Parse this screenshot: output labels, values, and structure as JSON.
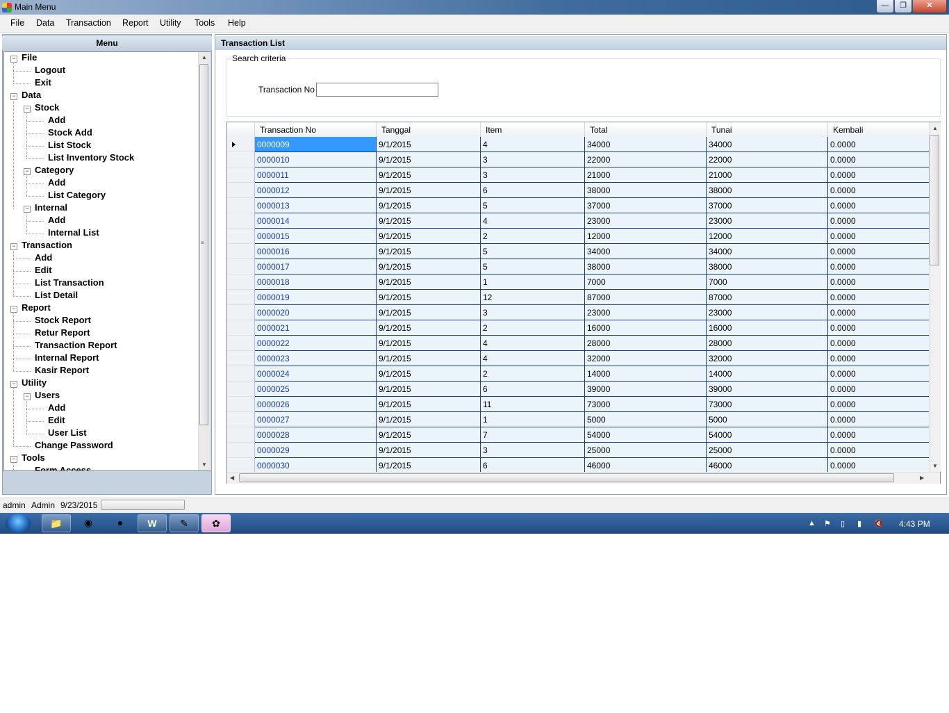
{
  "window": {
    "title": "Main Menu"
  },
  "menubar": [
    "File",
    "Data",
    "Transaction",
    "Report",
    "Utility",
    "Tools",
    "Help"
  ],
  "left_panel": {
    "title": "Menu"
  },
  "tree": [
    {
      "label": "File",
      "level": 0,
      "expanded": true
    },
    {
      "label": "Logout",
      "level": 1
    },
    {
      "label": "Exit",
      "level": 1
    },
    {
      "label": "Data",
      "level": 0,
      "expanded": true
    },
    {
      "label": "Stock",
      "level": 1,
      "expanded": true
    },
    {
      "label": "Add",
      "level": 2
    },
    {
      "label": "Stock Add",
      "level": 2
    },
    {
      "label": "List Stock",
      "level": 2
    },
    {
      "label": "List Inventory Stock",
      "level": 2
    },
    {
      "label": "Category",
      "level": 1,
      "expanded": true
    },
    {
      "label": "Add",
      "level": 2
    },
    {
      "label": "List Category",
      "level": 2
    },
    {
      "label": "Internal",
      "level": 1,
      "expanded": true
    },
    {
      "label": "Add",
      "level": 2
    },
    {
      "label": "Internal List",
      "level": 2
    },
    {
      "label": "Transaction",
      "level": 0,
      "expanded": true
    },
    {
      "label": "Add",
      "level": 1
    },
    {
      "label": "Edit",
      "level": 1
    },
    {
      "label": "List Transaction",
      "level": 1
    },
    {
      "label": "List Detail",
      "level": 1
    },
    {
      "label": "Report",
      "level": 0,
      "expanded": true
    },
    {
      "label": "Stock Report",
      "level": 1
    },
    {
      "label": "Retur Report",
      "level": 1
    },
    {
      "label": "Transaction Report",
      "level": 1
    },
    {
      "label": "Internal Report",
      "level": 1
    },
    {
      "label": "Kasir Report",
      "level": 1
    },
    {
      "label": "Utility",
      "level": 0,
      "expanded": true
    },
    {
      "label": "Users",
      "level": 1,
      "expanded": true
    },
    {
      "label": "Add",
      "level": 2
    },
    {
      "label": "Edit",
      "level": 2
    },
    {
      "label": "User List",
      "level": 2
    },
    {
      "label": "Change Password",
      "level": 1
    },
    {
      "label": "Tools",
      "level": 0,
      "expanded": true
    },
    {
      "label": "Form Access",
      "level": 1
    }
  ],
  "right_panel": {
    "title": "Transaction List",
    "search_legend": "Search criteria",
    "transaction_no_label": "Transaction No",
    "transaction_no_value": ""
  },
  "grid": {
    "columns": [
      "Transaction No",
      "Tanggal",
      "Item",
      "Total",
      "Tunai",
      "Kembali"
    ],
    "selected_row": 0,
    "rows": [
      [
        "0000009",
        "9/1/2015",
        "4",
        "34000",
        "34000",
        "0.0000"
      ],
      [
        "0000010",
        "9/1/2015",
        "3",
        "22000",
        "22000",
        "0.0000"
      ],
      [
        "0000011",
        "9/1/2015",
        "3",
        "21000",
        "21000",
        "0.0000"
      ],
      [
        "0000012",
        "9/1/2015",
        "6",
        "38000",
        "38000",
        "0.0000"
      ],
      [
        "0000013",
        "9/1/2015",
        "5",
        "37000",
        "37000",
        "0.0000"
      ],
      [
        "0000014",
        "9/1/2015",
        "4",
        "23000",
        "23000",
        "0.0000"
      ],
      [
        "0000015",
        "9/1/2015",
        "2",
        "12000",
        "12000",
        "0.0000"
      ],
      [
        "0000016",
        "9/1/2015",
        "5",
        "34000",
        "34000",
        "0.0000"
      ],
      [
        "0000017",
        "9/1/2015",
        "5",
        "38000",
        "38000",
        "0.0000"
      ],
      [
        "0000018",
        "9/1/2015",
        "1",
        "7000",
        "7000",
        "0.0000"
      ],
      [
        "0000019",
        "9/1/2015",
        "12",
        "87000",
        "87000",
        "0.0000"
      ],
      [
        "0000020",
        "9/1/2015",
        "3",
        "23000",
        "23000",
        "0.0000"
      ],
      [
        "0000021",
        "9/1/2015",
        "2",
        "16000",
        "16000",
        "0.0000"
      ],
      [
        "0000022",
        "9/1/2015",
        "4",
        "28000",
        "28000",
        "0.0000"
      ],
      [
        "0000023",
        "9/1/2015",
        "4",
        "32000",
        "32000",
        "0.0000"
      ],
      [
        "0000024",
        "9/1/2015",
        "2",
        "14000",
        "14000",
        "0.0000"
      ],
      [
        "0000025",
        "9/1/2015",
        "6",
        "39000",
        "39000",
        "0.0000"
      ],
      [
        "0000026",
        "9/1/2015",
        "11",
        "73000",
        "73000",
        "0.0000"
      ],
      [
        "0000027",
        "9/1/2015",
        "1",
        "5000",
        "5000",
        "0.0000"
      ],
      [
        "0000028",
        "9/1/2015",
        "7",
        "54000",
        "54000",
        "0.0000"
      ],
      [
        "0000029",
        "9/1/2015",
        "3",
        "25000",
        "25000",
        "0.0000"
      ],
      [
        "0000030",
        "9/1/2015",
        "6",
        "46000",
        "46000",
        "0.0000"
      ]
    ]
  },
  "statusbar": {
    "user_id": "admin",
    "user_name": "Admin",
    "date": "9/23/2015"
  },
  "taskbar": {
    "apps": [
      "file-explorer-icon",
      "chrome-icon",
      "firefox-icon",
      "word-icon",
      "paint-icon",
      "main-menu-app-icon"
    ],
    "clock": "4:43 PM"
  }
}
